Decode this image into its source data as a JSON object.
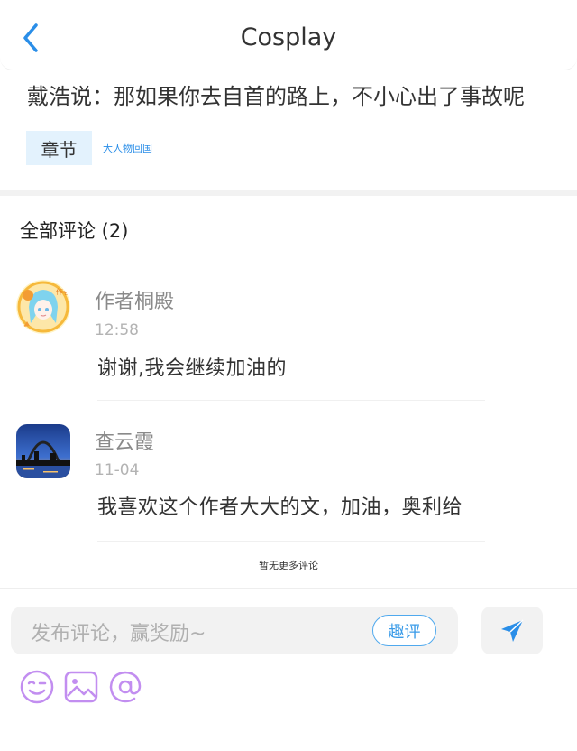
{
  "header": {
    "title": "Cosplay",
    "back_icon": "chevron-left-icon"
  },
  "quote": "戴浩说：那如果你去自首的路上，不小心出了事故呢",
  "chapter": {
    "tag": "章节",
    "link": "大人物回国"
  },
  "comments_title": "全部评论 (2)",
  "comments": [
    {
      "name": "作者桐殿",
      "time": "12:58",
      "text": "谢谢,我会继续加油的",
      "avatar": "anime-girl-avatar"
    },
    {
      "name": "查云霞",
      "time": "11-04",
      "text": "我喜欢这个作者大大的文，加油，奥利给",
      "avatar": "city-arch-avatar"
    }
  ],
  "no_more": "暂无更多评论",
  "composer": {
    "placeholder": "发布评论，赢奖励~",
    "quping_label": "趣评",
    "send_icon": "send-icon",
    "tools": [
      "emoji-icon",
      "image-icon",
      "at-icon"
    ]
  },
  "colors": {
    "accent": "#2a8ee8",
    "tag_bg": "#e3f2fd",
    "tool_purple": "#c28ef0"
  }
}
